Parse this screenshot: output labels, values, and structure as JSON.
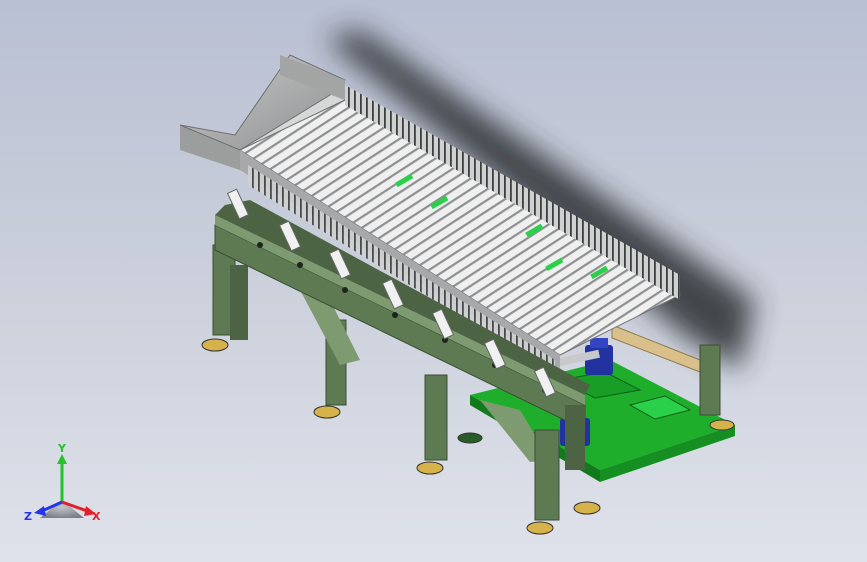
{
  "viewport": {
    "background_top": "#b9c0d3",
    "background_bottom": "#dfe2ea"
  },
  "colors": {
    "frame_green": "#5e7a52",
    "frame_green_dark": "#3b4d35",
    "frame_green_light": "#7e9a70",
    "base_green": "#1fae2c",
    "base_green_dark": "#117a1b",
    "hopper_grey": "#b2b3b3",
    "roller_light": "#e8e8e8",
    "roller_dark": "#8d8f90",
    "accent_green": "#2bd04a",
    "wood": "#d9c08a",
    "motor_blue": "#2233a0",
    "foot_yellow": "#d6b24a"
  },
  "triad": {
    "x_label": "X",
    "y_label": "Y",
    "z_label": "Z",
    "x_color": "#e0202a",
    "y_color": "#25c22a",
    "z_color": "#2633e6"
  }
}
